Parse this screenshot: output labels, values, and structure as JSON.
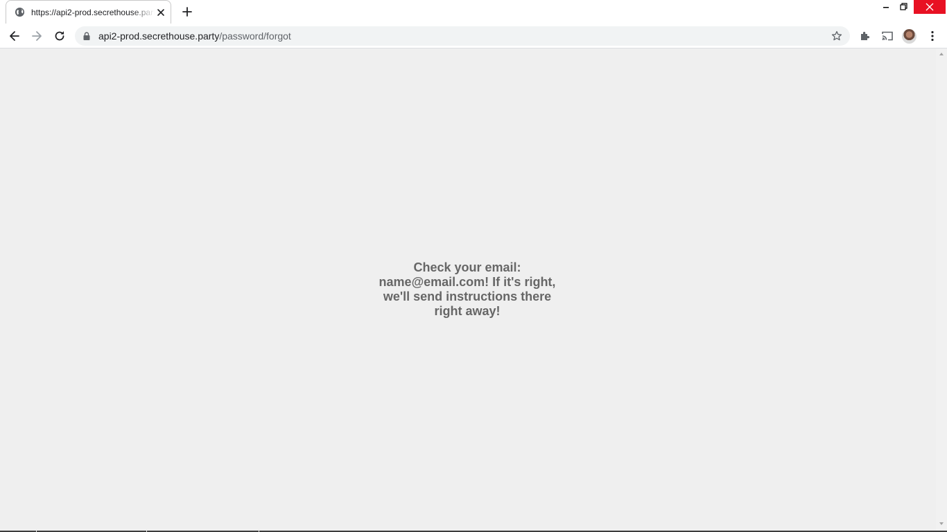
{
  "tab": {
    "title": "https://api2-prod.secrethouse.party/password/forgot",
    "favicon": "globe-icon"
  },
  "address_bar": {
    "host": "api2-prod.secrethouse.party",
    "path": "/password/forgot"
  },
  "toolbar": {
    "back": "back-arrow-icon",
    "forward": "forward-arrow-icon",
    "reload": "reload-icon",
    "bookmark": "star-icon",
    "extensions": "puzzle-icon",
    "cast": "cast-icon",
    "menu": "kebab-menu-icon"
  },
  "page": {
    "message": "Check your email: name@email.com! If it's right, we'll send instructions there right away!"
  },
  "colors": {
    "page_background": "#efefef",
    "message_text": "#666666",
    "close_button": "#e81123"
  }
}
